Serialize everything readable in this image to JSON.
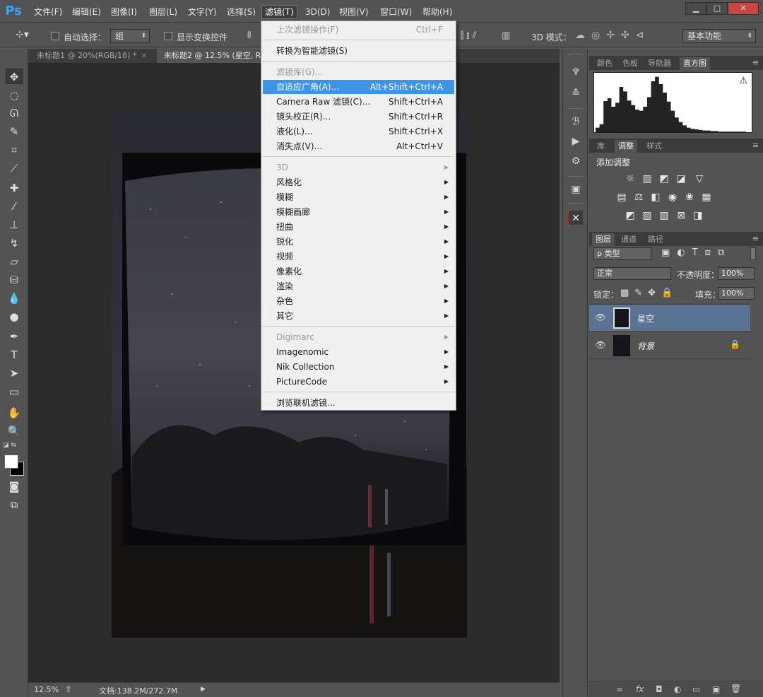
{
  "app": {
    "logo": "Ps"
  },
  "menubar": {
    "items": [
      {
        "label": "文件(F)"
      },
      {
        "label": "编辑(E)"
      },
      {
        "label": "图像(I)"
      },
      {
        "label": "图层(L)"
      },
      {
        "label": "文字(Y)"
      },
      {
        "label": "选择(S)"
      },
      {
        "label": "滤镜(T)"
      },
      {
        "label": "3D(D)"
      },
      {
        "label": "视图(V)"
      },
      {
        "label": "窗口(W)"
      },
      {
        "label": "帮助(H)"
      }
    ]
  },
  "window_controls": {
    "minimize": "▁",
    "maximize": "□",
    "close": "✕"
  },
  "options": {
    "auto_select_label": "自动选择：",
    "auto_select_value": "组",
    "show_transform_label": "显示变换控件",
    "mode_3d_label": "3D 模式：",
    "workspace_value": "基本功能"
  },
  "tabs": [
    {
      "label": "未标题1 @ 20%(RGB/16) *",
      "close": "×"
    },
    {
      "label": "未标题2 @ 12.5% (星空, RGB/16) *",
      "close": "×"
    }
  ],
  "filter_menu": {
    "groups": [
      [
        {
          "label": "上次滤镜操作(F)",
          "shortcut": "Ctrl+F",
          "disabled": true
        }
      ],
      [
        {
          "label": "转换为智能滤镜(S)"
        }
      ],
      [
        {
          "label": "滤镜库(G)...",
          "disabled": true
        },
        {
          "label": "自适应广角(A)...",
          "shortcut": "Alt+Shift+Ctrl+A",
          "highlighted": true
        },
        {
          "label": "Camera Raw 滤镜(C)...",
          "shortcut": "Shift+Ctrl+A"
        },
        {
          "label": "镜头校正(R)...",
          "shortcut": "Shift+Ctrl+R"
        },
        {
          "label": "液化(L)...",
          "shortcut": "Shift+Ctrl+X"
        },
        {
          "label": "消失点(V)...",
          "shortcut": "Alt+Ctrl+V"
        }
      ],
      [
        {
          "label": "3D",
          "submenu": true,
          "disabled": true
        },
        {
          "label": "风格化",
          "submenu": true
        },
        {
          "label": "模糊",
          "submenu": true
        },
        {
          "label": "模糊画廊",
          "submenu": true
        },
        {
          "label": "扭曲",
          "submenu": true
        },
        {
          "label": "锐化",
          "submenu": true
        },
        {
          "label": "视频",
          "submenu": true
        },
        {
          "label": "像素化",
          "submenu": true
        },
        {
          "label": "渲染",
          "submenu": true
        },
        {
          "label": "杂色",
          "submenu": true
        },
        {
          "label": "其它",
          "submenu": true
        }
      ],
      [
        {
          "label": "Digimarc",
          "submenu": true,
          "disabled": true
        },
        {
          "label": "Imagenomic",
          "submenu": true
        },
        {
          "label": "Nik Collection",
          "submenu": true
        },
        {
          "label": "PictureCode",
          "submenu": true
        }
      ],
      [
        {
          "label": "浏览联机滤镜..."
        }
      ]
    ],
    "submenu_arrow": "▶"
  },
  "panels": {
    "top_tabs": [
      "颜色",
      "色板",
      "导航器",
      "直方图"
    ],
    "histogram_warning": "⚠",
    "mid_tabs": [
      "库",
      "调整",
      "样式"
    ],
    "add_adjustment": "添加调整",
    "layers_tabs": [
      "图层",
      "通道",
      "路径"
    ],
    "filter_kind": "ρ 类型",
    "blend_mode": "正常",
    "opacity_label": "不透明度：",
    "opacity_value": "100%",
    "lock_label": "锁定：",
    "fill_label": "填充：",
    "fill_value": "100%",
    "layers": [
      {
        "name": "星空",
        "selected": true,
        "locked": false
      },
      {
        "name": "背景",
        "selected": false,
        "locked": true
      }
    ],
    "bottom_icons": [
      "∞",
      "fx",
      "◘",
      "◐",
      "▭",
      "▣",
      "🗑"
    ]
  },
  "status": {
    "zoom": "12.5%",
    "doc_info": "文档:138.2M/272.7M",
    "arrow": "▶"
  },
  "histogram": {
    "bars": [
      8,
      14,
      55,
      60,
      45,
      52,
      80,
      72,
      56,
      48,
      40,
      38,
      45,
      62,
      90,
      98,
      85,
      70,
      54,
      38,
      26,
      18,
      12,
      8,
      6,
      5,
      4,
      3,
      3,
      2,
      2,
      1,
      1,
      1,
      1,
      1,
      1,
      1
    ]
  },
  "colors": {
    "accent": "#3d95e8",
    "selected_layer": "#5a7394"
  }
}
